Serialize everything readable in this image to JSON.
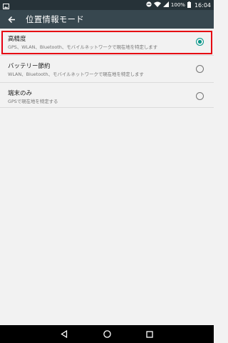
{
  "status_bar": {
    "battery": "100%",
    "time": "16:04",
    "icons": [
      "photo-notification-icon",
      "do-not-disturb-icon",
      "wifi-icon",
      "battery-icon"
    ]
  },
  "app_bar": {
    "title": "位置情報モード",
    "back_icon": "arrow-back-icon"
  },
  "options": [
    {
      "title": "高精度",
      "subtitle": "GPS、WLAN、Bluetooth、モバイルネットワークで現在地を特定します",
      "selected": true
    },
    {
      "title": "バッテリー節約",
      "subtitle": "WLAN、Bluetooth、モバイルネットワークで現在地を特定します",
      "selected": false
    },
    {
      "title": "端末のみ",
      "subtitle": "GPSで現在地を特定する",
      "selected": false
    }
  ],
  "navigation": {
    "buttons": [
      "back-triangle-icon",
      "home-circle-icon",
      "recents-square-icon"
    ]
  },
  "colors": {
    "status_bar": "#263238",
    "app_bar": "#37474f",
    "accent": "#009688",
    "highlight": "#e60012"
  }
}
